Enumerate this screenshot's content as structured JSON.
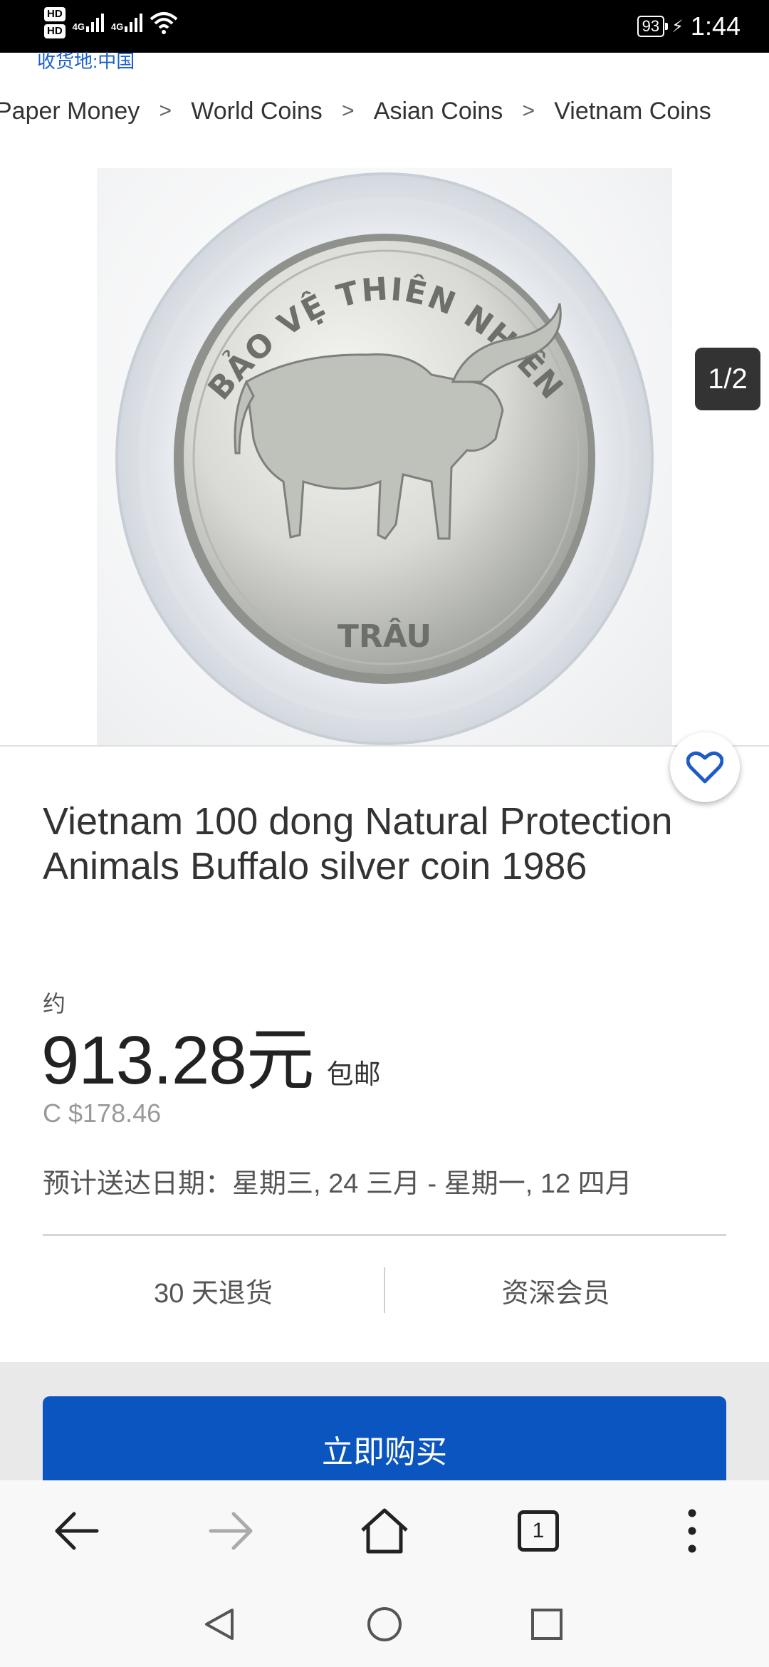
{
  "status_bar": {
    "hd1": "HD",
    "hd2": "HD",
    "net1": "4G",
    "net2": "4G",
    "battery": "93",
    "time": "1:44"
  },
  "page": {
    "top_fragment": "收货地:中国",
    "breadcrumb": [
      "Paper Money",
      "World Coins",
      "Asian Coins",
      "Vietnam Coins"
    ],
    "image_counter": "1/2",
    "coin_text_top": "BẢO VỆ THIÊN NHIÊN",
    "coin_text_bottom": "TRÂU",
    "title": "Vietnam 100 dong Natural Protection Animals Buffalo silver coin 1986",
    "approx_label": "约",
    "price": "913.28元",
    "shipping": "包邮",
    "original_price": "C $178.46",
    "delivery": "预计送达日期：星期三, 24 三月 - 星期一, 12 四月",
    "policies": [
      "30 天退货",
      "资深会员"
    ],
    "buy_button": "立即购买"
  },
  "browser_nav": {
    "tabs_count": "1"
  },
  "icons": {
    "favorite": "heart-icon",
    "back": "arrow-left-icon",
    "forward": "arrow-right-icon",
    "home": "home-icon",
    "tabs": "tabs-icon",
    "menu": "more-vertical-icon"
  },
  "colors": {
    "accent_blue": "#0a55bf",
    "heart_blue": "#1e5bc6",
    "counter_bg": "#333333",
    "page_bg": "#ffffff",
    "band_gray": "#e9e9ea"
  }
}
